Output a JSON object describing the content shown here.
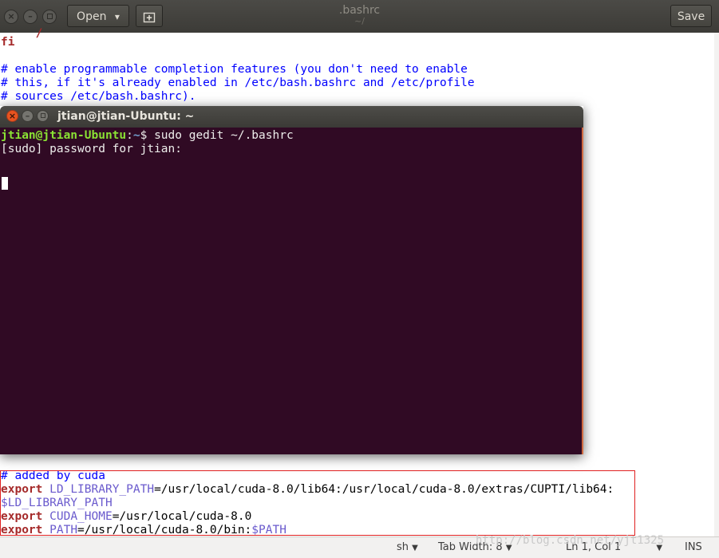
{
  "gedit": {
    "open_label": "Open",
    "open_chevron": "▾",
    "new_tab_icon": "new-tab-icon",
    "title": ".bashrc",
    "subtitle": "~/",
    "save_label": "Save",
    "window_buttons": [
      "close",
      "minimize",
      "maximize"
    ]
  },
  "editor_top_lines": [
    {
      "kind": "code",
      "text": "fi"
    },
    {
      "kind": "comment",
      "text": "# enable programmable completion features (you don't need to enable"
    },
    {
      "kind": "comment",
      "text": "# this, if it's already enabled in /etc/bash.bashrc and /etc/profile"
    },
    {
      "kind": "comment",
      "text": "# sources /etc/bash.bashrc)."
    }
  ],
  "editor_bottom": {
    "comment": "# added by cuda",
    "export_kw": "export",
    "line1_var": "LD_LIBRARY_PATH",
    "line1_rest": "=/usr/local/cuda-8.0/lib64:/usr/local/cuda-8.0/extras/CUPTI/lib64:",
    "line2": "$LD_LIBRARY_PATH",
    "line3_var": "CUDA_HOME",
    "line3_rest": "=/usr/local/cuda-8.0",
    "line4_var": "PATH",
    "line4_rest": "=/usr/local/cuda-8.0/bin:",
    "line4_tail": "$PATH"
  },
  "terminal": {
    "title": "jtian@jtian-Ubuntu: ~",
    "prompt_user": "jtian@jtian-Ubuntu",
    "prompt_sep": ":",
    "prompt_path": "~",
    "prompt_dollar": "$ ",
    "command": "sudo gedit ~/.bashrc",
    "output": "[sudo] password for jtian:"
  },
  "statusbar": {
    "language": "sh",
    "tab_width": "Tab Width: 8",
    "position": "Ln 1, Col 1",
    "mode": "INS"
  },
  "watermark": "http://blog.csdn.net/yjt1325",
  "colors": {
    "terminal_bg": "#300a24",
    "prompt_user": "#8ae234",
    "prompt_path": "#729fcf",
    "keyword": "#a52a2a",
    "comment": "#0000ff",
    "highlight": "#e02020"
  }
}
